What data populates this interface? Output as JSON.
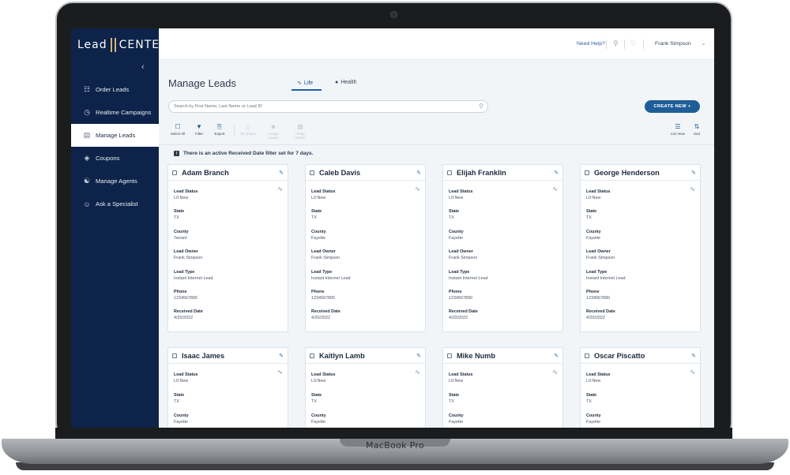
{
  "device": {
    "label": "MacBook Pro"
  },
  "brand": {
    "left": "Lead",
    "right": "CENTER"
  },
  "sidebar": {
    "items": [
      {
        "label": "Order Leads",
        "icon": "order-icon",
        "active": false
      },
      {
        "label": "Realtime Campaigns",
        "icon": "clock-icon",
        "active": false
      },
      {
        "label": "Manage Leads",
        "icon": "leads-card-icon",
        "active": true
      },
      {
        "label": "Coupons",
        "icon": "tag-icon",
        "active": false
      },
      {
        "label": "Manage Agents",
        "icon": "agents-icon",
        "active": false
      },
      {
        "label": "Ask a Specialist",
        "icon": "specialist-icon",
        "active": false
      }
    ]
  },
  "header": {
    "help": "Need Help?",
    "user": "Frank Simpson"
  },
  "main": {
    "title": "Manage Leads",
    "tabs": [
      {
        "label": "Life"
      },
      {
        "label": "Health"
      }
    ],
    "search_placeholder": "Search by First Name, Last Name or Lead ID",
    "create_label": "CREATE NEW +",
    "toolbar": {
      "select_all": "Select All",
      "filter": "Filter",
      "export": "Export",
      "disabled1": "Tie Status",
      "disabled2": "Assign Leads",
      "disabled3": "Assign Status",
      "list_view": "List View",
      "sort": "Sort"
    },
    "notice": "There is an active Received Date filter set for 7 days."
  },
  "field_labels": {
    "status": "Lead Status",
    "state": "State",
    "county": "County",
    "owner": "Lead Owner",
    "type": "Lead Type",
    "phone": "Phone",
    "received": "Received Date"
  },
  "leads": [
    {
      "name": "Adam Branch",
      "status": "L0:New",
      "state": "TX",
      "county": "Tarrant",
      "owner": "Frank Simpson",
      "type": "Instant Internet Lead",
      "phone": "1234567890",
      "received": "4/20/2022"
    },
    {
      "name": "Caleb Davis",
      "status": "L0:New",
      "state": "TX",
      "county": "Fayette",
      "owner": "Frank Simpson",
      "type": "Instant Internet Lead",
      "phone": "1234567890",
      "received": "4/20/2022"
    },
    {
      "name": "Elijah Franklin",
      "status": "L0:New",
      "state": "TX",
      "county": "Fayette",
      "owner": "Frank Simpson",
      "type": "Instant Internet Lead",
      "phone": "1234567890",
      "received": "4/20/2022"
    },
    {
      "name": "George Henderson",
      "status": "L0:New",
      "state": "TX",
      "county": "Fayette",
      "owner": "Frank Simpson",
      "type": "Instant Internet Lead",
      "phone": "1234567890",
      "received": "4/20/2022"
    },
    {
      "name": "Isaac James",
      "status": "L0:New",
      "state": "TX",
      "county": "Fayette"
    },
    {
      "name": "Kaitlyn Lamb",
      "status": "L0:New",
      "state": "TX",
      "county": "Fayette"
    },
    {
      "name": "Mike Numb",
      "status": "L0:New",
      "state": "TX",
      "county": "Fayette"
    },
    {
      "name": "Oscar Piscatto",
      "status": "L0:New",
      "state": "TX",
      "county": "Fayette"
    }
  ]
}
